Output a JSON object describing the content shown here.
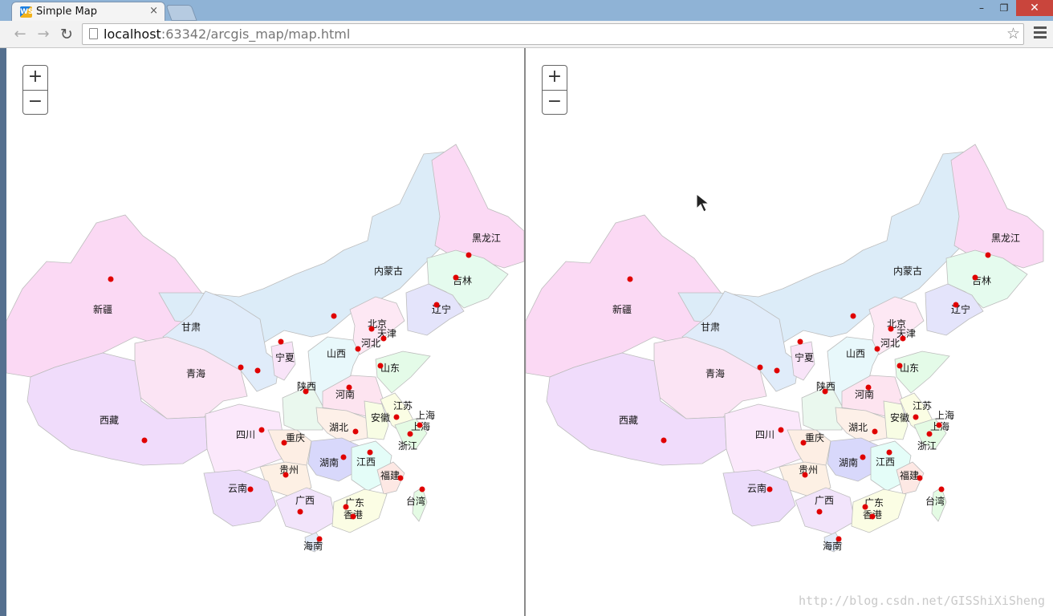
{
  "browser": {
    "tab_title": "Simple Map",
    "favicon_text": "WS",
    "tab_close": "×",
    "url_host": "localhost",
    "url_rest": ":63342/arcgis_map/map.html",
    "window_controls": [
      "–",
      "❐",
      "✕"
    ]
  },
  "map": {
    "zoom_in": "+",
    "zoom_out": "−",
    "watermark": "http://blog.csdn.net/GISShiXiSheng",
    "marker_color": "#e00000",
    "labels": [
      "黑龙江",
      "吉林",
      "内蒙古",
      "辽宁",
      "新疆",
      "甘肃",
      "北京",
      "天津",
      "河北",
      "宁夏",
      "山西",
      "山东",
      "青海",
      "陕西",
      "河南",
      "江苏",
      "上海",
      "安徽",
      "上海",
      "西藏",
      "四川",
      "重庆",
      "湖北",
      "浙江",
      "湖南",
      "江西",
      "贵州",
      "福建",
      "云南",
      "台湾",
      "广西",
      "广东",
      "香港",
      "海南"
    ]
  }
}
